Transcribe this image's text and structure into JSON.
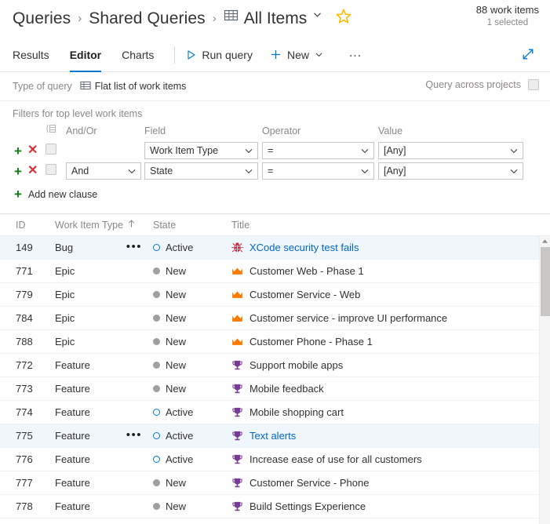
{
  "breadcrumb": {
    "root": "Queries",
    "separator": "›",
    "folder": "Shared Queries",
    "current": "All Items",
    "grid_icon": "table-grid-icon",
    "chevron_icon": "chevron-down-icon",
    "favorite_icon": "star-icon"
  },
  "counts": {
    "work_items": "88 work items",
    "selected": "1 selected"
  },
  "toolbar": {
    "tabs": [
      {
        "label": "Results",
        "active": false
      },
      {
        "label": "Editor",
        "active": true
      },
      {
        "label": "Charts",
        "active": false
      }
    ],
    "run_query": "Run query",
    "run_icon": "play-triangle-icon",
    "new": "New",
    "new_icon": "plus-icon",
    "new_chevron": "chevron-down-icon",
    "more": "…",
    "more_name": "more-commands-ellipsis",
    "expand_icon": "expand-diagonal-icon",
    "accent_color": "#0078d4"
  },
  "query_type": {
    "label": "Type of query",
    "value": "Flat list of work items",
    "value_icon": "flat-list-grid-icon",
    "across_projects_label": "Query across projects",
    "across_projects_checked": false
  },
  "filters": {
    "title": "Filters for top level work items",
    "group_icon": "group-clauses-icon",
    "headers": {
      "andor": "And/Or",
      "field": "Field",
      "operator": "Operator",
      "value": "Value"
    },
    "add_clause": "Add new clause",
    "add_clause_icon": "plus-icon",
    "add_row_icon": "plus-icon",
    "remove_row_icon": "x-icon",
    "clauses": [
      {
        "andor": "",
        "field": "Work Item Type",
        "operator": "=",
        "value": "[Any]",
        "checked": false
      },
      {
        "andor": "And",
        "field": "State",
        "operator": "=",
        "value": "[Any]",
        "checked": false
      }
    ]
  },
  "results_grid": {
    "columns": [
      {
        "key": "id",
        "label": "ID",
        "sorted": false
      },
      {
        "key": "type",
        "label": "Work Item Type",
        "sorted": true,
        "sort_icon": "sort-ascending-arrow-icon"
      },
      {
        "key": "state",
        "label": "State",
        "sorted": false
      },
      {
        "key": "title",
        "label": "Title",
        "sorted": false
      }
    ],
    "rows": [
      {
        "id": "149",
        "type": "Bug",
        "state": "Active",
        "title": "XCode security test fails",
        "icon": "bug-icon",
        "selected": true,
        "menu": true,
        "link": true
      },
      {
        "id": "771",
        "type": "Epic",
        "state": "New",
        "title": "Customer Web - Phase 1",
        "icon": "crown-icon",
        "selected": false,
        "menu": false,
        "link": false
      },
      {
        "id": "779",
        "type": "Epic",
        "state": "New",
        "title": "Customer Service - Web",
        "icon": "crown-icon",
        "selected": false,
        "menu": false,
        "link": false
      },
      {
        "id": "784",
        "type": "Epic",
        "state": "New",
        "title": "Customer service - improve UI performance",
        "icon": "crown-icon",
        "selected": false,
        "menu": false,
        "link": false
      },
      {
        "id": "788",
        "type": "Epic",
        "state": "New",
        "title": "Customer Phone - Phase 1",
        "icon": "crown-icon",
        "selected": false,
        "menu": false,
        "link": false
      },
      {
        "id": "772",
        "type": "Feature",
        "state": "New",
        "title": "Support mobile apps",
        "icon": "trophy-icon",
        "selected": false,
        "menu": false,
        "link": false
      },
      {
        "id": "773",
        "type": "Feature",
        "state": "New",
        "title": "Mobile feedback",
        "icon": "trophy-icon",
        "selected": false,
        "menu": false,
        "link": false
      },
      {
        "id": "774",
        "type": "Feature",
        "state": "Active",
        "title": "Mobile shopping cart",
        "icon": "trophy-icon",
        "selected": false,
        "menu": false,
        "link": false
      },
      {
        "id": "775",
        "type": "Feature",
        "state": "Active",
        "title": "Text alerts",
        "icon": "trophy-icon",
        "selected": true,
        "menu": true,
        "link": true
      },
      {
        "id": "776",
        "type": "Feature",
        "state": "Active",
        "title": "Increase ease of use for all customers",
        "icon": "trophy-icon",
        "selected": false,
        "menu": false,
        "link": false
      },
      {
        "id": "777",
        "type": "Feature",
        "state": "New",
        "title": "Customer Service - Phone",
        "icon": "trophy-icon",
        "selected": false,
        "menu": false,
        "link": false
      },
      {
        "id": "778",
        "type": "Feature",
        "state": "New",
        "title": "Build Settings Experience",
        "icon": "trophy-icon",
        "selected": false,
        "menu": false,
        "link": false
      }
    ],
    "row_menu_icon": "context-menu-ellipsis-icon",
    "scrollbar_up_icon": "scroll-up-arrow-icon"
  },
  "colors": {
    "accent": "#0078d4",
    "bug": "#cc293d",
    "epic": "#ff7b00",
    "feature": "#773b93",
    "state_active": "#007acc",
    "state_new": "#a19f9d",
    "selected_row_bg": "#eff6fc",
    "add": "#107c10",
    "remove": "#d13438",
    "star": "#ffb900"
  }
}
